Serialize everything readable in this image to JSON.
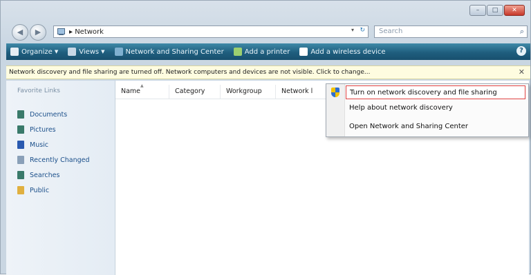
{
  "window": {
    "caption_min": "–",
    "caption_max": "□",
    "caption_close": "✕"
  },
  "nav": {
    "back_glyph": "◀",
    "forward_glyph": "▶"
  },
  "address": {
    "path": "▸ Network",
    "dropdown_glyph": "▾",
    "refresh_glyph": "↻"
  },
  "search": {
    "placeholder": "Search",
    "icon": "search-icon"
  },
  "toolbar": {
    "items": [
      {
        "label": "Organize",
        "icon": "organize-icon",
        "color": "#e6eef4",
        "has_arrow": true
      },
      {
        "label": "Views",
        "icon": "views-icon",
        "color": "#c8d8e6",
        "has_arrow": true
      },
      {
        "label": "Network and Sharing Center",
        "icon": "network-center-icon",
        "color": "#7fb0d0",
        "has_arrow": false
      },
      {
        "label": "Add a printer",
        "icon": "printer-icon",
        "color": "#9ccf70",
        "has_arrow": false
      },
      {
        "label": "Add a wireless device",
        "icon": "wireless-device-icon",
        "color": "#ffffff",
        "has_arrow": false
      }
    ],
    "help_glyph": "?"
  },
  "infobar": {
    "message": "Network discovery and file sharing are turned off. Network computers and devices are not visible. Click to change...",
    "close_glyph": "✕"
  },
  "favorites": {
    "title": "Favorite Links",
    "items": [
      {
        "label": "Documents",
        "icon": "documents-icon",
        "color": "#3a7a6a"
      },
      {
        "label": "Pictures",
        "icon": "pictures-icon",
        "color": "#3a7a6a"
      },
      {
        "label": "Music",
        "icon": "music-icon",
        "color": "#2a5ab0"
      },
      {
        "label": "Recently Changed",
        "icon": "recently-changed-icon",
        "color": "#8aa0b8"
      },
      {
        "label": "Searches",
        "icon": "searches-icon",
        "color": "#3a7a6a"
      },
      {
        "label": "Public",
        "icon": "public-icon",
        "color": "#e0b040"
      }
    ]
  },
  "columns": [
    "Name",
    "Category",
    "Workgroup",
    "Network l"
  ],
  "popup": {
    "items": [
      {
        "label": "Turn on network discovery and file sharing",
        "highlight": true
      },
      {
        "label": "Help about network discovery",
        "highlight": false
      },
      {
        "label": "Open Network and Sharing Center",
        "highlight": false
      }
    ]
  },
  "colors": {
    "toolbar": "#1f5e7e",
    "infobar": "#fefce0",
    "highlight_border": "#e04040"
  }
}
